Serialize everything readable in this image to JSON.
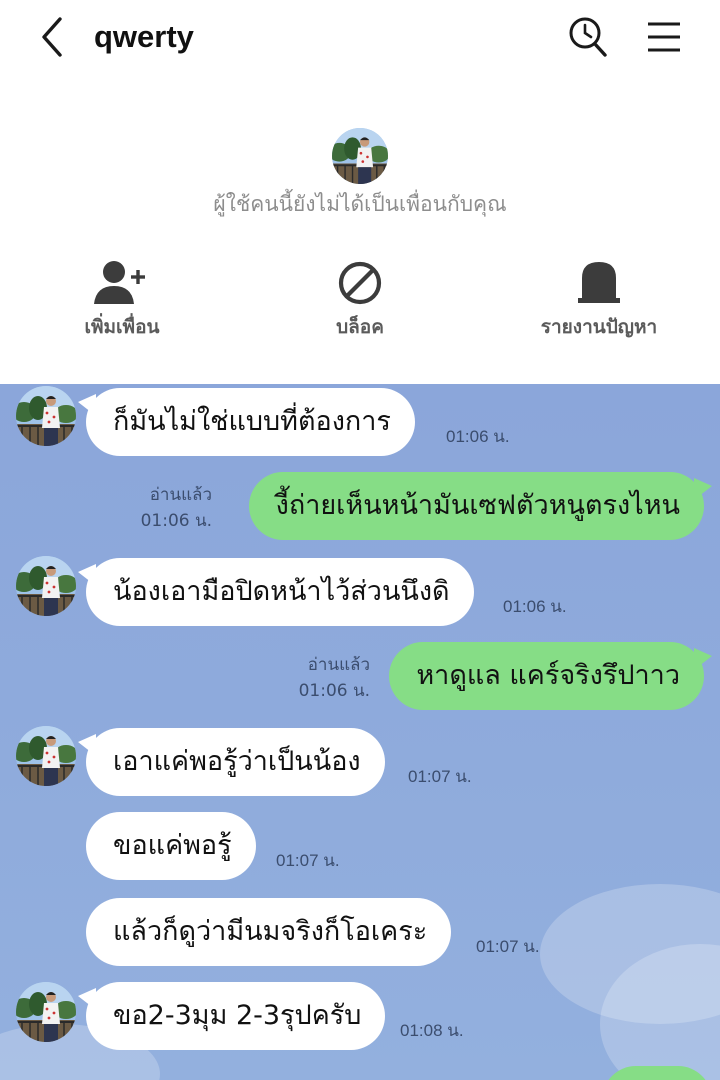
{
  "header": {
    "title": "qwerty"
  },
  "profile": {
    "notice": "ผู้ใช้คนนี้ยังไม่ได้เป็นเพื่อนกับคุณ"
  },
  "actions": {
    "add_friend": "เพิ่มเพื่อน",
    "block": "บล็อค",
    "report": "รายงานปัญหา"
  },
  "messages": [
    {
      "direction": "in",
      "text": "ก็มันไม่ใช่แบบที่ต้องการ",
      "time": "01:06 น."
    },
    {
      "direction": "out",
      "text": "งี้ถ่ายเห็นหน้ามันเซฟตัวหนูตรงไหน",
      "time": "01:06 น.",
      "status": "อ่านแล้ว"
    },
    {
      "direction": "in",
      "text": "น้องเอามือปิดหน้าไว้ส่วนนึงดิ",
      "time": "01:06 น."
    },
    {
      "direction": "out",
      "text": "หาดูแล แคร์จริงรึปาาว",
      "time": "01:06 น.",
      "status": "อ่านแล้ว"
    },
    {
      "direction": "in",
      "text": "เอาแค่พอรู้ว่าเป็นน้อง",
      "time": "01:07 น."
    },
    {
      "direction": "in",
      "text": "ขอแค่พอรู้",
      "time": "01:07 น."
    },
    {
      "direction": "in",
      "text": "แล้วก็ดูว่ามีนมจริงก็โอเคระ",
      "time": "01:07 น."
    },
    {
      "direction": "in",
      "text": "ขอ2-3มุม 2-3รุปครับ",
      "time": "01:08 น."
    }
  ],
  "colors": {
    "incoming_bubble": "#ffffff",
    "outgoing_bubble": "#86dd86",
    "chat_background": "#8ba6da"
  }
}
